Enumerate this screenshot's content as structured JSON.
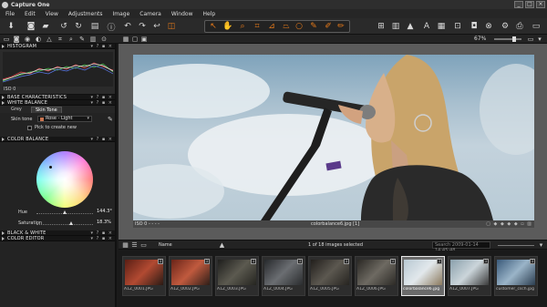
{
  "app": {
    "title": "Capture One"
  },
  "menu": [
    "File",
    "Edit",
    "View",
    "Adjustments",
    "Image",
    "Camera",
    "Window",
    "Help"
  ],
  "toolbar": {
    "zoom": "67%"
  },
  "panels": {
    "histogram": {
      "title": "HISTOGRAM",
      "iso": "ISO 0"
    },
    "base_characteristics": {
      "title": "BASE CHARACTERISTICS"
    },
    "white_balance": {
      "title": "WHITE BALANCE",
      "tabs": [
        "Grey",
        "Skin Tone"
      ],
      "skin_tone_label": "Skin tone",
      "skin_tone_value": "Rose - Light",
      "pick_label": "Pick to create new"
    },
    "color_balance": {
      "title": "COLOR BALANCE",
      "hue_label": "Hue",
      "hue_value": "144.3°",
      "saturation_label": "Saturation",
      "saturation_value": "18.3%"
    },
    "black_white": {
      "title": "BLACK & WHITE"
    },
    "color_editor": {
      "title": "COLOR EDITOR"
    }
  },
  "viewer": {
    "iso": "ISO 0 - - - -",
    "filename": "colorbalance6.jpg [1]"
  },
  "browser": {
    "sort_label": "Name",
    "selection_count": "1 of 18 images selected",
    "search_placeholder": "Search 2009-01-14 14:45:48"
  },
  "filmstrip": [
    {
      "caption": "A1Z_0001.JPG",
      "color": "#7a2a1c"
    },
    {
      "caption": "A1Z_0002.JPG",
      "color": "#8a3322"
    },
    {
      "caption": "A1Z_0003.JPG",
      "color": "#33332c"
    },
    {
      "caption": "A1Z_0004.JPG",
      "color": "#3b3f44"
    },
    {
      "caption": "A1Z_0005.JPG",
      "color": "#34322e"
    },
    {
      "caption": "A1Z_0006.JPG",
      "color": "#3c3a36"
    },
    {
      "caption": "colorbalance6.jpg",
      "color": "#c9d3d8"
    },
    {
      "caption": "A1Z_0007.JPG",
      "color": "#5d6e78"
    },
    {
      "caption": "customer_csch.jpg",
      "color": "#5b7f9e"
    }
  ]
}
